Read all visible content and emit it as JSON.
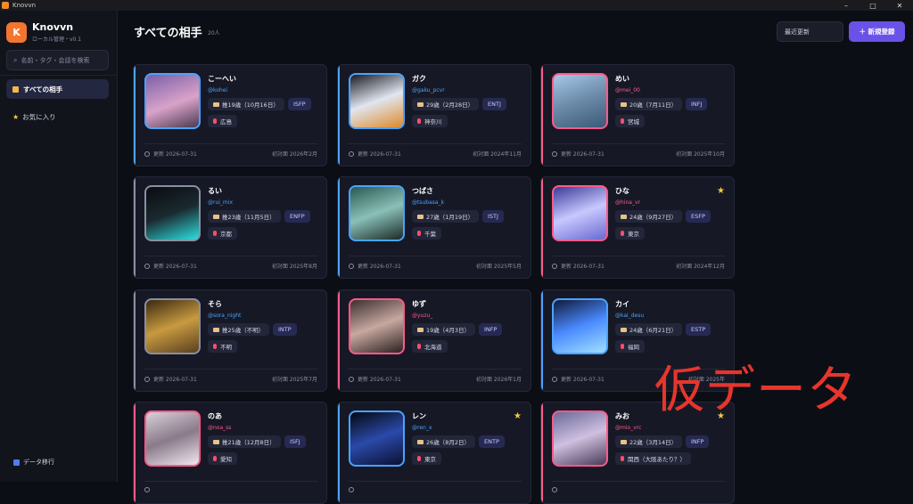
{
  "window": {
    "title": "Knovvn"
  },
  "app": {
    "name": "Knovvn",
    "subtitle": "ローカル管理・v0.1",
    "logo_letter": "K"
  },
  "sidebar": {
    "search_placeholder": "名前・タグ・会話を検索",
    "items": [
      {
        "label": "すべての相手",
        "icon": "folder-icon",
        "active": true
      },
      {
        "label": "お気に入り",
        "icon": "star-icon",
        "active": false
      }
    ],
    "footer": {
      "label": "データ移行",
      "icon": "transfer-icon"
    }
  },
  "header": {
    "title": "すべての相手",
    "count": "20人",
    "sort_label": "最近更新",
    "new_button": "＋ 新規登録"
  },
  "colors": {
    "accent": "#6a52e8",
    "blue": "#4aa3ff",
    "pink": "#ff5a8a",
    "gray": "#8a8fa3"
  },
  "cards": [
    {
      "name": "こーへい",
      "handle": "@kohei",
      "age": "推19歳（10月16日）",
      "mbti": "ISFP",
      "location": "広島",
      "updated": "更新 2026-07-31",
      "first_met": "初対面 2026年2月",
      "favorite": false,
      "accent": "blue"
    },
    {
      "name": "ガク",
      "handle": "@gaku_pcvr",
      "age": "29歳（2月28日）",
      "mbti": "ENTJ",
      "location": "神奈川",
      "updated": "更新 2026-07-31",
      "first_met": "初対面 2024年11月",
      "favorite": false,
      "accent": "blue"
    },
    {
      "name": "めい",
      "handle": "@mei_00",
      "age": "20歳（7月11日）",
      "mbti": "INFJ",
      "location": "宮城",
      "updated": "更新 2026-07-31",
      "first_met": "初対面 2025年10月",
      "favorite": false,
      "accent": "pink"
    },
    {
      "name": "るい",
      "handle": "@rui_mix",
      "age": "推23歳（11月5日）",
      "mbti": "ENFP",
      "location": "京都",
      "updated": "更新 2026-07-31",
      "first_met": "初対面 2025年8月",
      "favorite": false,
      "accent": "gray"
    },
    {
      "name": "つばさ",
      "handle": "@tsubasa_k",
      "age": "27歳（1月19日）",
      "mbti": "ISTJ",
      "location": "千葉",
      "updated": "更新 2026-07-31",
      "first_met": "初対面 2025年5月",
      "favorite": false,
      "accent": "blue"
    },
    {
      "name": "ひな",
      "handle": "@hina_vr",
      "age": "24歳（9月27日）",
      "mbti": "ESFP",
      "location": "東京",
      "updated": "更新 2026-07-31",
      "first_met": "初対面 2024年12月",
      "favorite": true,
      "accent": "pink"
    },
    {
      "name": "そら",
      "handle": "@sora_night",
      "age": "推25歳（不明）",
      "mbti": "INTP",
      "location": "不明",
      "updated": "更新 2026-07-31",
      "first_met": "初対面 2025年7月",
      "favorite": false,
      "accent": "gray"
    },
    {
      "name": "ゆず",
      "handle": "@yuzu_",
      "age": "19歳（4月3日）",
      "mbti": "INFP",
      "location": "北海道",
      "updated": "更新 2026-07-31",
      "first_met": "初対面 2026年1月",
      "favorite": false,
      "accent": "pink"
    },
    {
      "name": "カイ",
      "handle": "@kai_desu",
      "age": "24歳（6月21日）",
      "mbti": "ESTP",
      "location": "福岡",
      "updated": "更新 2026-07-31",
      "first_met": "初対面 2025年",
      "favorite": false,
      "accent": "blue"
    },
    {
      "name": "のあ",
      "handle": "@noa_ss",
      "age": "推21歳（12月8日）",
      "mbti": "ISFJ",
      "location": "愛知",
      "updated": "",
      "first_met": "",
      "favorite": false,
      "accent": "pink"
    },
    {
      "name": "レン",
      "handle": "@ren_x",
      "age": "26歳（8月2日）",
      "mbti": "ENTP",
      "location": "東京",
      "updated": "",
      "first_met": "",
      "favorite": true,
      "accent": "blue"
    },
    {
      "name": "みお",
      "handle": "@mio_vrc",
      "age": "22歳（3月14日）",
      "mbti": "INFP",
      "location": "関西（大阪あたり？）",
      "updated": "",
      "first_met": "",
      "favorite": true,
      "accent": "pink"
    }
  ],
  "watermark": "仮データ"
}
